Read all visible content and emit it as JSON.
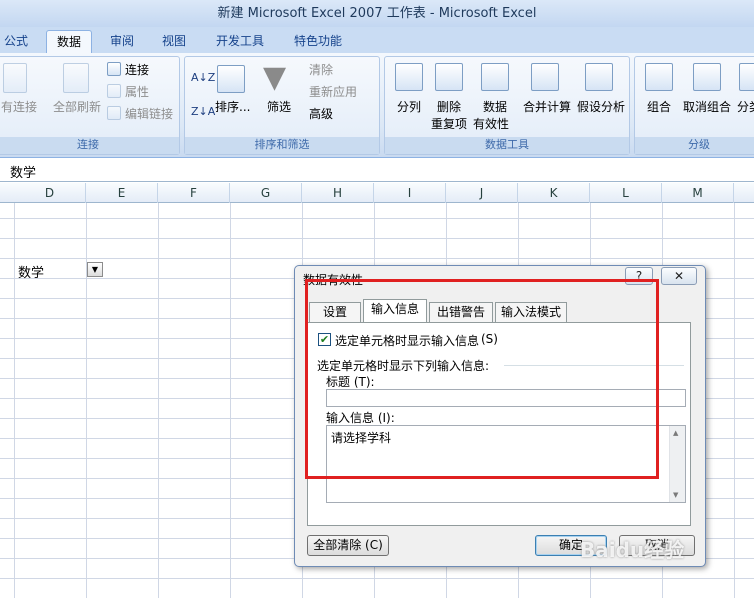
{
  "window": {
    "title": "新建 Microsoft Excel 2007 工作表 - Microsoft Excel"
  },
  "tabs": [
    "公式",
    "数据",
    "审阅",
    "视图",
    "开发工具",
    "特色功能"
  ],
  "ribbon": {
    "connections": {
      "existing": "有连接",
      "refresh_all": "全部刷新",
      "connections": "连接",
      "properties": "属性",
      "edit_links": "编辑链接",
      "label": "连接"
    },
    "sort_filter": {
      "sort": "排序...",
      "filter": "筛选",
      "clear": "清除",
      "reapply": "重新应用",
      "advanced": "高级",
      "label": "排序和筛选"
    },
    "data_tools": {
      "text_to_columns": "分列",
      "remove_dup_1": "删除",
      "remove_dup_2": "重复项",
      "validation_1": "数据",
      "validation_2": "有效性",
      "consolidate": "合并计算",
      "what_if": "假设分析",
      "label": "数据工具"
    },
    "outline": {
      "group": "组合",
      "ungroup": "取消组合",
      "subtotal": "分类",
      "label": "分级"
    }
  },
  "formula_bar": {
    "content": "数学"
  },
  "columns": [
    "D",
    "E",
    "F",
    "G",
    "H",
    "I",
    "J",
    "K",
    "L",
    "M"
  ],
  "cell": {
    "value": "数学"
  },
  "dialog": {
    "title": "数据有效性",
    "help": "?",
    "close": "✕",
    "tabs": [
      "设置",
      "输入信息",
      "出错警告",
      "输入法模式"
    ],
    "checkbox_label": "选定单元格时显示输入信息",
    "checkbox_key": "(S)",
    "checkbox_checked": true,
    "section_label": "选定单元格时显示下列输入信息:",
    "title_label": "标题 (T):",
    "title_value": "",
    "message_label": "输入信息 (I):",
    "message_value": "请选择学科",
    "clear_all": "全部清除 (C)",
    "ok": "确定",
    "cancel": "取消"
  },
  "watermark": "Baidu经验",
  "colors": {
    "highlight": "#e02020",
    "ribbon_text": "#15428b"
  }
}
